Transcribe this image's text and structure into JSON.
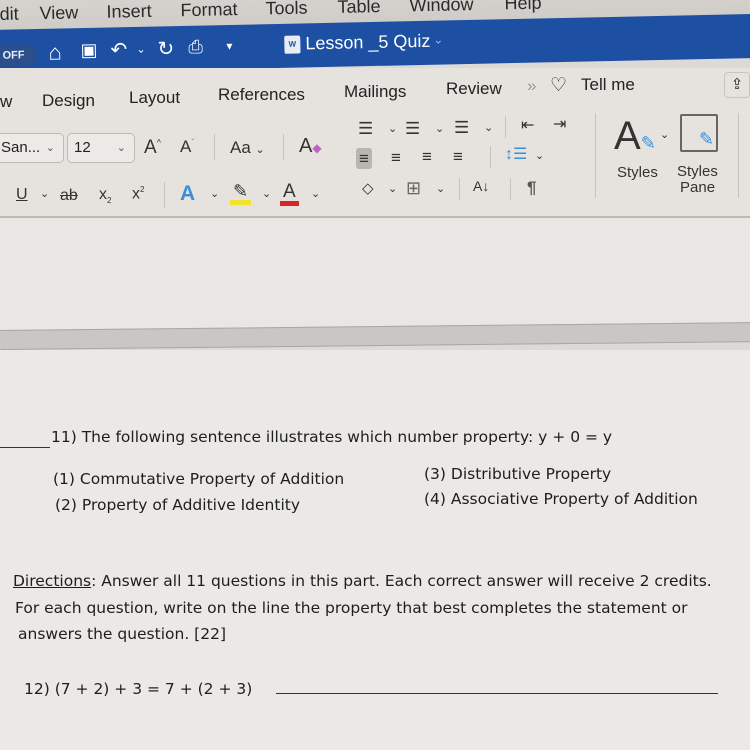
{
  "menubar": {
    "items": [
      "dit",
      "View",
      "Insert",
      "Format",
      "Tools",
      "Table",
      "Window",
      "Help"
    ]
  },
  "titlebar": {
    "autosave_label": "OFF",
    "quick_access": [
      "home-icon",
      "save-icon",
      "undo-icon",
      "redo-icon",
      "print-icon",
      "customize-icon"
    ],
    "document_title": "Lesson _5 Quiz",
    "doc_icon_label": "W"
  },
  "ribbon": {
    "tabs": [
      "w",
      "Design",
      "Layout",
      "References",
      "Mailings",
      "Review"
    ],
    "more_tabs": "»",
    "tell_me": "Tell me",
    "font_name": "San...",
    "font_size": "12",
    "grow_font": "A",
    "shrink_font": "A",
    "change_case": "Aa",
    "underline": "U",
    "strikethrough": "ab",
    "subscript": "x",
    "superscript": "x",
    "text_effects": "A",
    "font_color": "A",
    "sort": "A↓",
    "pilcrow": "¶",
    "styles_label": "Styles",
    "styles_pane_label_1": "Styles",
    "styles_pane_label_2": "Pane",
    "colors": {
      "title_bar": "#1d4fa3",
      "highlight": "#f2e22c",
      "font_color": "#d8232a",
      "accent_blue": "#3b8ed8"
    }
  },
  "document": {
    "q11": {
      "prompt": "11) The following sentence illustrates which number property:  y + 0 = y",
      "choices": [
        "(1) Commutative Property of Addition",
        "(2) Property of Additive Identity",
        "(3) Distributive Property",
        "(4) Associative Property of Addition"
      ]
    },
    "directions": {
      "label": "Directions",
      "line1": ": Answer all 11 questions in this part. Each correct answer will receive 2 credits.",
      "line2": "For each question, write on the line the property that best completes the statement or",
      "line3": "answers the question. [22]"
    },
    "q12": {
      "prompt": "12) (7 + 2) + 3 = 7 + (2 + 3)"
    }
  }
}
